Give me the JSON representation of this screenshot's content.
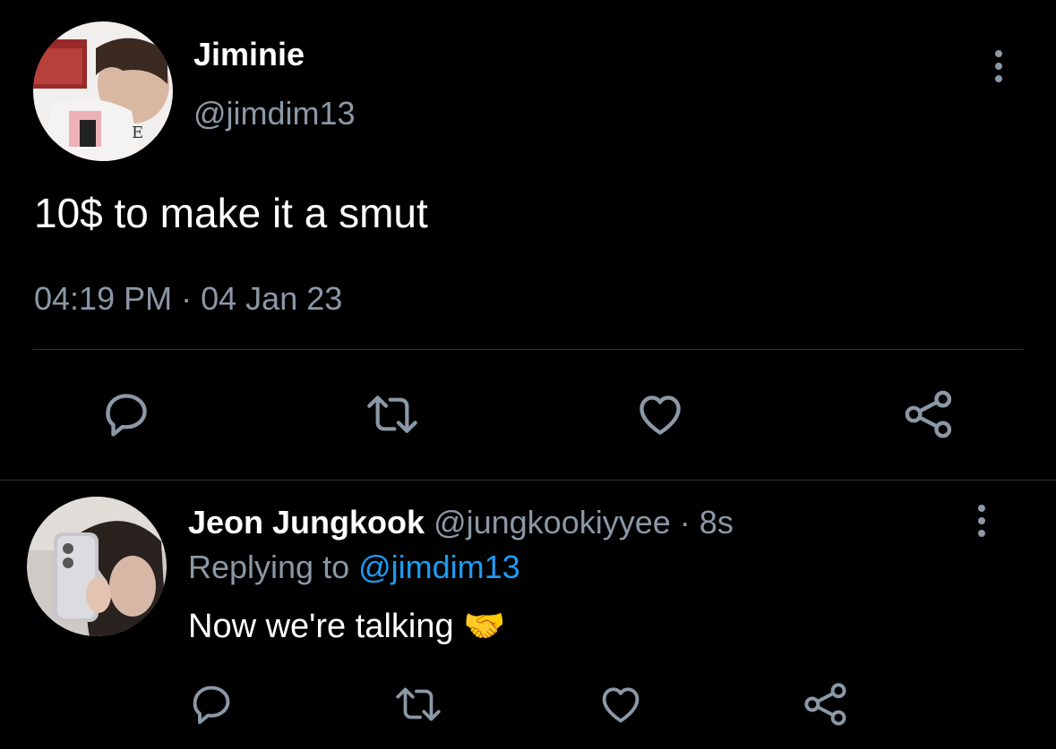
{
  "tweet": {
    "author_name": "Jiminie",
    "handle": "@jimdim13",
    "text": "10$ to make it a smut",
    "time": "04:19 PM",
    "separator": "·",
    "date": "04 Jan 23",
    "actions": [
      "reply-icon",
      "retweet-icon",
      "like-icon",
      "share-icon"
    ]
  },
  "reply": {
    "author_name": "Jeon Jungkook",
    "handle": "@jungkookiyyee",
    "separator": "·",
    "age": "8s",
    "replying_prefix": "Replying to",
    "replying_handle": "@jimdim13",
    "text": "Now we're talking",
    "emoji": "🤝",
    "actions": [
      "reply-icon",
      "retweet-icon",
      "like-icon",
      "share-icon"
    ]
  },
  "colors": {
    "background": "#000000",
    "text_primary": "#ffffff",
    "text_secondary": "#8b98a5",
    "link": "#1d9bf0",
    "divider": "#2f3336"
  }
}
